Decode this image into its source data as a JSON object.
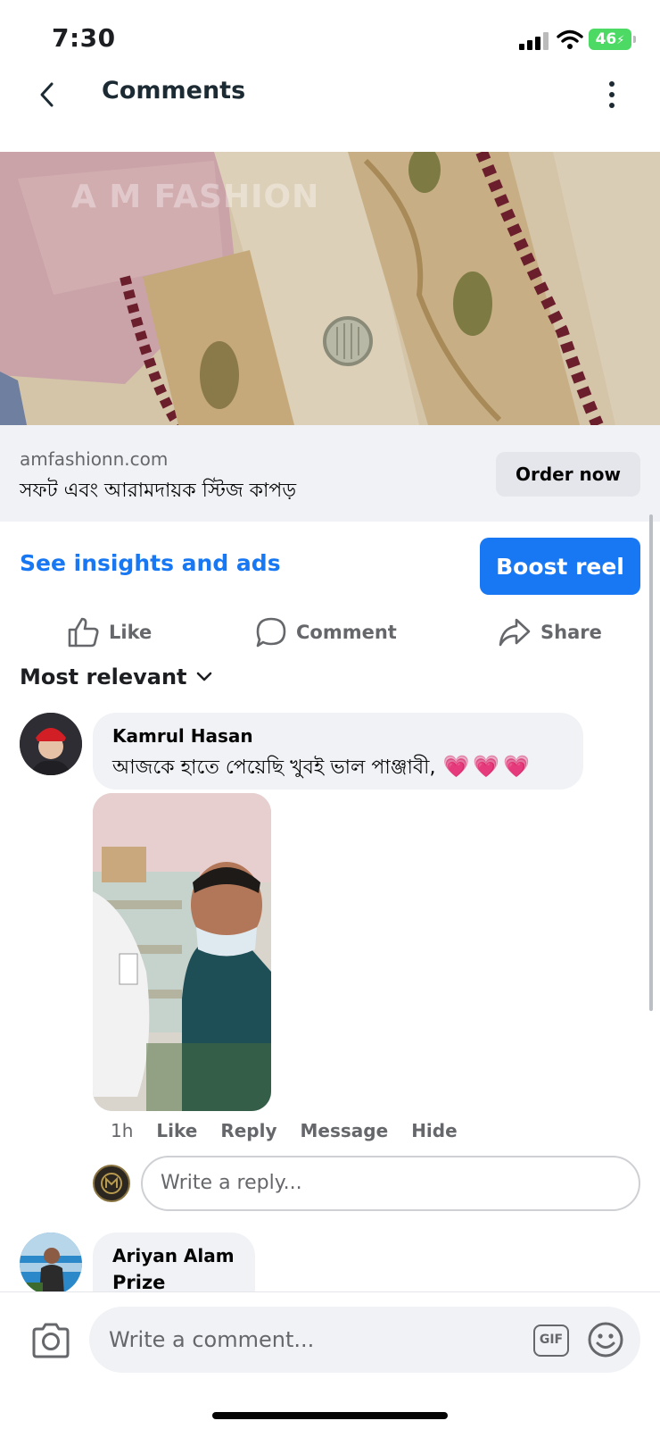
{
  "status": {
    "time": "7:30",
    "battery": "46"
  },
  "header": {
    "title": "Comments"
  },
  "media": {
    "watermark": "A M FASHION"
  },
  "link": {
    "domain": "amfashionn.com",
    "headline": "সফট এবং আরামদায়ক স্টিজ কাপড়",
    "cta": "Order now"
  },
  "insights": {
    "link_label": "See insights and ads",
    "boost_label": "Boost reel"
  },
  "actions": {
    "like": "Like",
    "comment": "Comment",
    "share": "Share"
  },
  "sort": {
    "label": "Most relevant"
  },
  "comments": [
    {
      "author": "Kamrul Hasan",
      "text": "আজকে হাতে পেয়েছি খুবই ভাল পাঞ্জাবী,",
      "emoji": "💗💗💗",
      "time": "1h",
      "actions": [
        "Like",
        "Reply",
        "Message",
        "Hide"
      ]
    },
    {
      "author": "Ariyan Alam",
      "text": "Prize"
    }
  ],
  "reply": {
    "placeholder": "Write a reply..."
  },
  "composer": {
    "placeholder": "Write a comment...",
    "gif_label": "GIF"
  },
  "colors": {
    "accent": "#1877f2",
    "secondary_text": "#65676b",
    "bubble": "#f0f2f5"
  },
  "icons": [
    "back-chevron-icon",
    "more-vertical-icon",
    "like-icon",
    "comment-icon",
    "share-icon",
    "chevron-down-icon",
    "camera-icon",
    "gif-icon",
    "emoji-icon"
  ]
}
